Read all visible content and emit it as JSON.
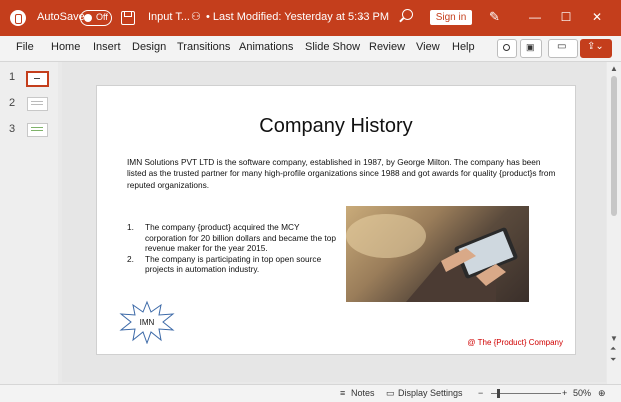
{
  "titlebar": {
    "autosave_label": "AutoSave",
    "autosave_state": "Off",
    "filename": "Input T...",
    "modified": "• Last Modified: Yesterday at 5:33 PM",
    "signin_label": "Sign in",
    "colors": {
      "accent": "#c43e1c"
    }
  },
  "ribbon": {
    "tabs": [
      "File",
      "Home",
      "Insert",
      "Design",
      "Transitions",
      "Animations",
      "Slide Show",
      "Review",
      "View",
      "Help"
    ]
  },
  "thumbnails": [
    {
      "number": "1",
      "active": true
    },
    {
      "number": "2",
      "active": false
    },
    {
      "number": "3",
      "active": false
    }
  ],
  "slide": {
    "title": "Company History",
    "paragraph": "IMN Solutions PVT LTD is the software company, established in 1987, by George Milton. The company has been listed as the trusted partner for many high-profile organizations since 1988 and got awards for quality {product}s from reputed organizations.",
    "bullets": [
      {
        "num": "1.",
        "text": "The company {product} acquired the MCY corporation for 20 billion dollars and became the top revenue maker for the year 2015."
      },
      {
        "num": "2.",
        "text": "The company is participating in top open source projects in automation industry."
      }
    ],
    "starburst_text": "IMN",
    "footer": "@ The {Product} Company"
  },
  "statusbar": {
    "notes": "Notes",
    "display_settings": "Display Settings",
    "zoom": "50%"
  }
}
